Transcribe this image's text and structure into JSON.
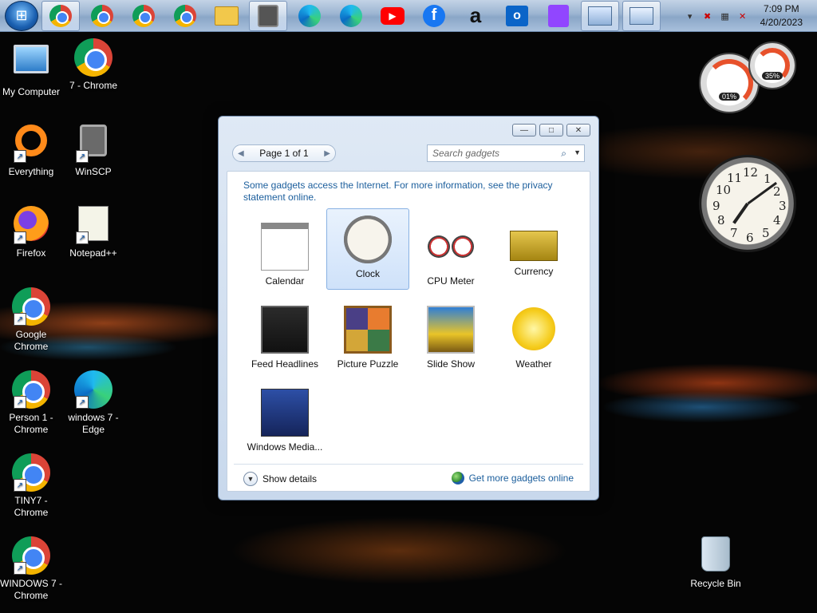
{
  "taskbar": {
    "start_label": "Start",
    "pinned": [
      {
        "name": "chrome",
        "icon": "chrome-icon",
        "active": true
      },
      {
        "name": "chrome",
        "icon": "chrome-icon",
        "active": false
      },
      {
        "name": "chrome",
        "icon": "chrome-icon",
        "active": false
      },
      {
        "name": "chrome",
        "icon": "chrome-icon",
        "active": false
      },
      {
        "name": "explorer",
        "icon": "folder-icon",
        "active": false
      },
      {
        "name": "winscp",
        "icon": "lock-icon",
        "active": true
      },
      {
        "name": "edge",
        "icon": "edge-icon",
        "active": false
      },
      {
        "name": "edge",
        "icon": "edge-icon",
        "active": false
      },
      {
        "name": "youtube",
        "icon": "youtube-icon",
        "active": false
      },
      {
        "name": "facebook",
        "icon": "facebook-icon",
        "active": false
      },
      {
        "name": "amazon",
        "icon": "amazon-icon",
        "active": false
      },
      {
        "name": "outlook",
        "icon": "outlook-icon",
        "active": false
      },
      {
        "name": "twitch",
        "icon": "twitch-icon",
        "active": false
      },
      {
        "name": "gadgets",
        "icon": "gadget-gallery-icon",
        "active": true
      },
      {
        "name": "display",
        "icon": "monitor-icon",
        "active": true
      }
    ],
    "tray": {
      "time": "7:09 PM",
      "date": "4/20/2023",
      "icons": [
        "chevron-up-icon",
        "network-error-icon",
        "network-icon",
        "volume-muted-icon"
      ]
    }
  },
  "desktop": {
    "icons": [
      {
        "label": "My Computer",
        "icon": "computer-icon"
      },
      {
        "label": "7 - Chrome",
        "icon": "chrome-icon"
      },
      {
        "label": "Everything",
        "icon": "everything-icon"
      },
      {
        "label": "WinSCP",
        "icon": "winscp-icon"
      },
      {
        "label": "Firefox",
        "icon": "firefox-icon"
      },
      {
        "label": "Notepad++",
        "icon": "notepad-icon"
      },
      {
        "label": "Google Chrome",
        "icon": "chrome-icon"
      },
      {
        "label": "Person 1 - Chrome",
        "icon": "chrome-icon"
      },
      {
        "label": "windows 7 - Edge",
        "icon": "edge-icon"
      },
      {
        "label": "TINY7 - Chrome",
        "icon": "chrome-icon"
      },
      {
        "label": "WINDOWS 7 - Chrome",
        "icon": "chrome-icon"
      },
      {
        "label": "Recycle Bin",
        "icon": "recycle-bin-icon"
      }
    ]
  },
  "side_gadgets": {
    "cpu_meter": {
      "cpu": "01%",
      "memory": "35%"
    },
    "clock": {
      "numbers": [
        "12",
        "1",
        "2",
        "3",
        "4",
        "5",
        "6",
        "7",
        "8",
        "9",
        "10",
        "11"
      ]
    }
  },
  "gallery": {
    "window_controls": {
      "minimize": "—",
      "maximize": "□",
      "close": "✕"
    },
    "pager": {
      "label": "Page 1 of 1",
      "prev": "◀",
      "next": "▶"
    },
    "search": {
      "placeholder": "Search gadgets"
    },
    "notice": "Some gadgets access the Internet.  For more information, see the privacy statement online.",
    "gadgets": [
      {
        "label": "Calendar",
        "selected": false
      },
      {
        "label": "Clock",
        "selected": true
      },
      {
        "label": "CPU Meter",
        "selected": false
      },
      {
        "label": "Currency",
        "selected": false
      },
      {
        "label": "Feed Headlines",
        "selected": false
      },
      {
        "label": "Picture Puzzle",
        "selected": false
      },
      {
        "label": "Slide Show",
        "selected": false
      },
      {
        "label": "Weather",
        "selected": false
      },
      {
        "label": "Windows Media...",
        "selected": false
      }
    ],
    "footer": {
      "show_details": "Show details",
      "more_online": "Get more gadgets online"
    }
  }
}
